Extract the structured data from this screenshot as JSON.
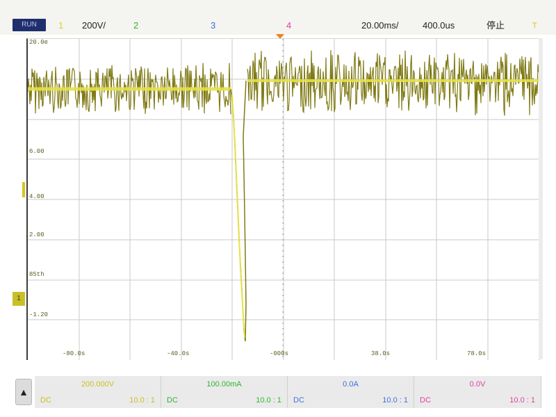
{
  "topbar": {
    "run_label": "RUN",
    "ch1": "1",
    "volt_div": "200V/",
    "ch2": "2",
    "ch3": "3",
    "ch4": "4",
    "time_div": "20.00ms/",
    "delay": "400.0us",
    "status": "停止",
    "trig_icon": "T"
  },
  "colors": {
    "ch1": "#d9d42a",
    "ch2": "#2db52d",
    "ch3": "#3f6fe0",
    "ch4": "#e040a0",
    "wave": "#7a7a10"
  },
  "y_labels": [
    "20.0e",
    "6.00",
    "4.00",
    "2.00",
    "85th",
    "-1.20"
  ],
  "x_labels": [
    "-80.0s",
    "-40.0s",
    "-000s",
    "38.0s",
    "78.0s"
  ],
  "channels": [
    {
      "scale": "200.000V",
      "coupling": "DC",
      "probe": "10.0 : 1"
    },
    {
      "scale": "100.00mA",
      "coupling": "DC",
      "probe": "10.0 : 1"
    },
    {
      "scale": "0.0A",
      "coupling": "DC",
      "probe": "10.0 : 1"
    },
    {
      "scale": "0.0V",
      "coupling": "DC",
      "probe": "10.0 : 1"
    }
  ]
}
